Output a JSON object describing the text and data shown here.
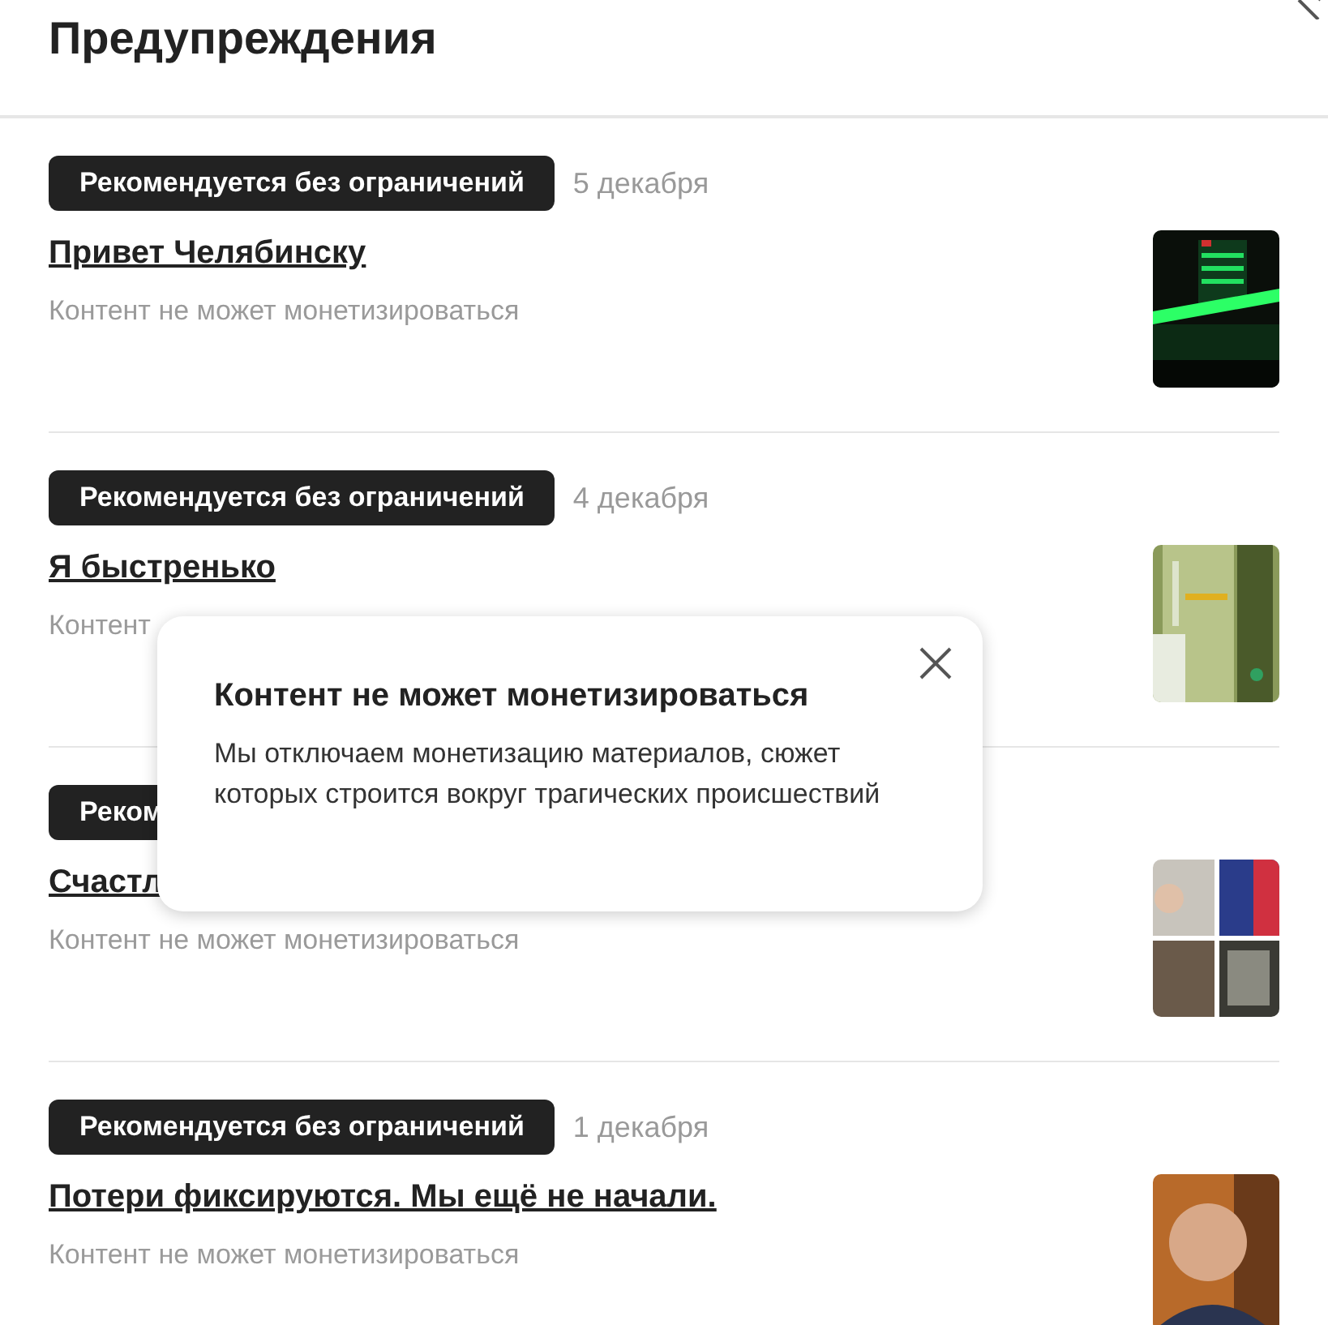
{
  "header": {
    "title": "Предупреждения"
  },
  "items": [
    {
      "badge": "Рекомендуется без ограничений",
      "date": "5 декабря",
      "title": "Привет Челябинску",
      "status": "Контент не может монетизироваться"
    },
    {
      "badge": "Рекомендуется без ограничений",
      "date": "4 декабря",
      "title": "Я быстренько",
      "status": "Контент"
    },
    {
      "badge": "Реком",
      "title": "Счастл",
      "status": "Контент не может монетизироваться"
    },
    {
      "badge": "Рекомендуется без ограничений",
      "date": "1 декабря",
      "title": "Потери фиксируются. Мы ещё не начали.",
      "status": "Контент не может монетизироваться"
    }
  ],
  "tooltip": {
    "title": "Контент не может монетизироваться",
    "text": "Мы отключаем монетизацию материалов, сюжет которых строится вокруг трагических происшествий"
  }
}
